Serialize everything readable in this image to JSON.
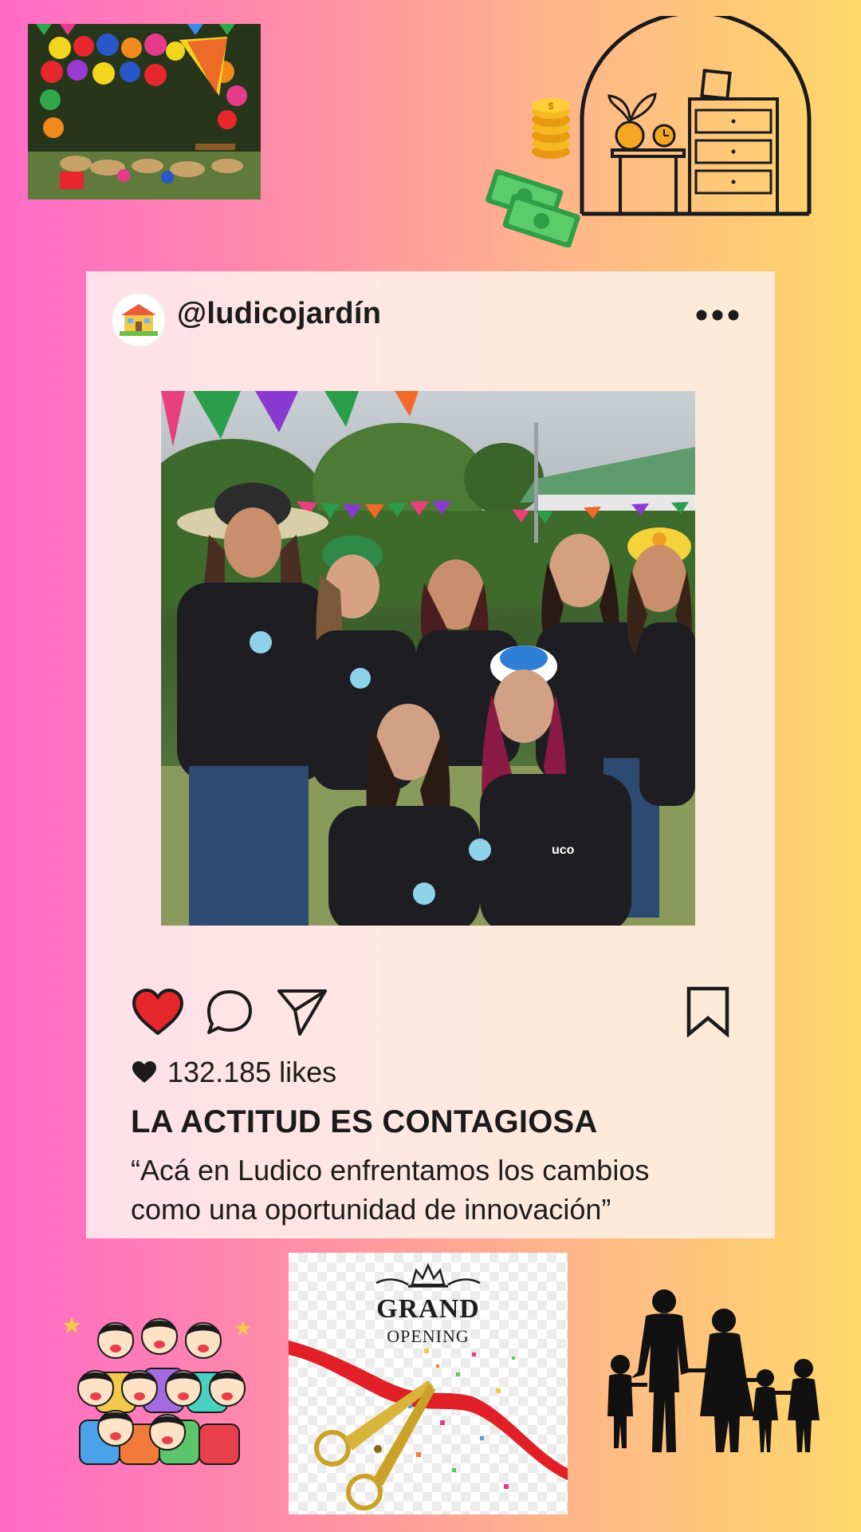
{
  "post": {
    "username": "@ludicojardín",
    "likes": "132.185 likes",
    "heading": "LA ACTITUD ES CONTAGIOSA",
    "caption_line1": "“Acá en Ludico enfrentamos los cambios",
    "caption_line2": "como una oportunidad de innovación”",
    "liked": true
  },
  "grand_opening": {
    "title": "GRAND",
    "subtitle": "OPENING"
  },
  "colors": {
    "background_left": "#ff6ac7",
    "background_right": "#ffd86a",
    "card": "#ffe8e0",
    "like_red": "#e5262a",
    "text": "#1b1b1b"
  },
  "icons": [
    "more-icon",
    "heart-icon",
    "comment-icon",
    "send-icon",
    "bookmark-icon",
    "small-heart-icon"
  ]
}
